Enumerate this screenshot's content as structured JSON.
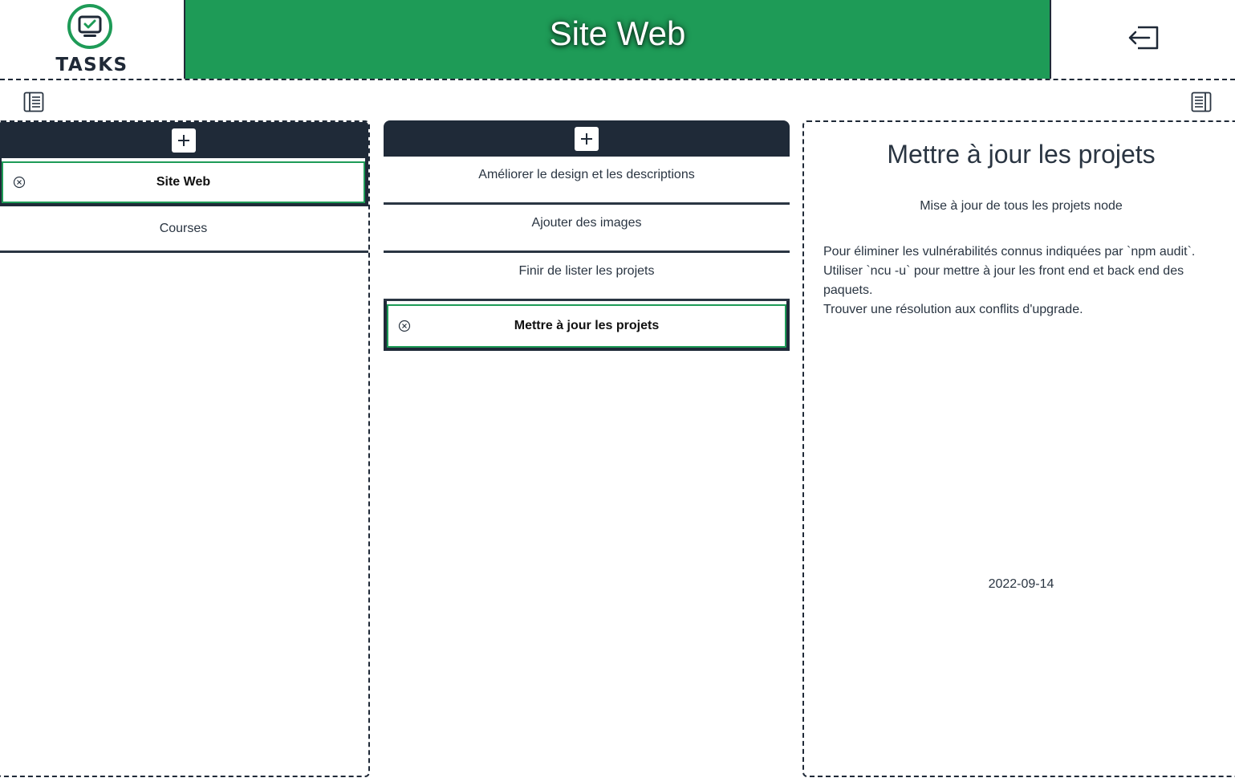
{
  "header": {
    "logo_text": "TASKS",
    "title": "Site Web"
  },
  "colors": {
    "accent": "#1e9b57",
    "dark": "#1f2a38",
    "text": "#2a3542"
  },
  "projects": {
    "items": [
      {
        "label": "Site Web",
        "selected": true
      },
      {
        "label": "Courses",
        "selected": false
      }
    ]
  },
  "tasks": {
    "items": [
      {
        "label": "Améliorer le design et les descriptions",
        "selected": false
      },
      {
        "label": "Ajouter des images",
        "selected": false
      },
      {
        "label": "Finir de lister les projets",
        "selected": false
      },
      {
        "label": "Mettre à jour les projets",
        "selected": true
      }
    ]
  },
  "detail": {
    "title": "Mettre à jour les projets",
    "subtitle": "Mise à jour de tous les projets node",
    "body": "Pour éliminer les vulnérabilités connus indiquées par `npm audit`.\nUtiliser `ncu -u` pour mettre à jour les front end  et back end des paquets.\nTrouver une résolution aux conflits d'upgrade.",
    "date": "2022-09-14"
  },
  "icons": {
    "logo": "monitor-check-icon",
    "logout": "logout-icon",
    "toggle_left": "sidebar-left-icon",
    "toggle_right": "sidebar-right-icon",
    "add": "plus-icon",
    "delete": "close-circle-icon"
  }
}
